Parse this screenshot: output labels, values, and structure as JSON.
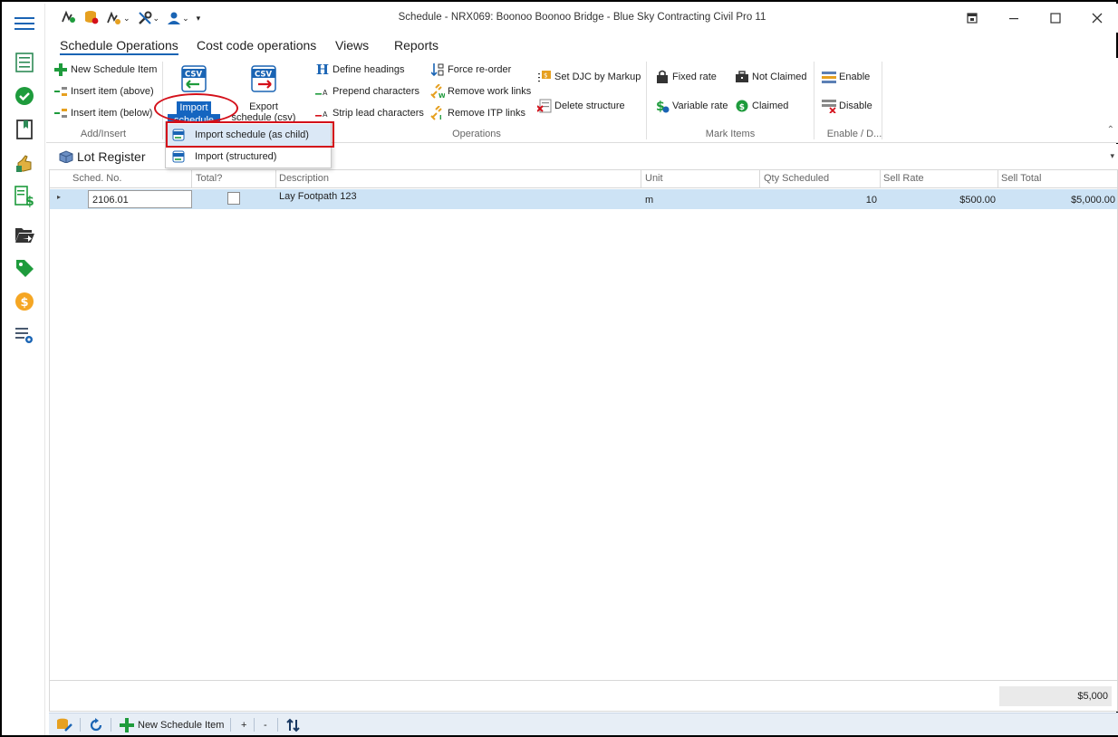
{
  "window": {
    "title": "Schedule - NRX069: Boonoo Boonoo Bridge - Blue Sky Contracting Civil Pro 11",
    "controls": [
      "restore-alt",
      "minimize",
      "maximize",
      "close"
    ]
  },
  "tabs": [
    {
      "label": "Schedule Operations",
      "active": true
    },
    {
      "label": "Cost code operations"
    },
    {
      "label": "Views"
    },
    {
      "label": "Reports"
    }
  ],
  "ribbon": {
    "add_insert": {
      "new_item": "New Schedule Item",
      "insert_above": "Insert item (above)",
      "insert_below": "Insert item (below)",
      "group_label": "Add/Insert"
    },
    "import": {
      "line1": "Import",
      "line2": "schedule ⌄",
      "csv_label": "CSV"
    },
    "export": {
      "line1": "Export",
      "line2": "schedule (csv) ⌄",
      "csv_label": "CSV"
    },
    "operations": {
      "define_headings": "Define headings",
      "prepend_chars": "Prepend characters",
      "strip_lead_chars": "Strip lead characters",
      "force_reorder": "Force re-order",
      "remove_work_links": "Remove work links",
      "remove_itp_links": "Remove ITP links",
      "set_djc": "Set DJC by Markup",
      "delete_structure": "Delete structure",
      "group_label": "Operations"
    },
    "mark_items": {
      "fixed_rate": "Fixed rate",
      "variable_rate": "Variable rate",
      "not_claimed": "Not Claimed",
      "claimed": "Claimed",
      "group_label": "Mark Items"
    },
    "enable_disable": {
      "enable": "Enable",
      "disable": "Disable",
      "group_label": "Enable / D..."
    }
  },
  "dropdown": {
    "items": [
      {
        "label": "Import schedule (as child)",
        "highlighted": true
      },
      {
        "label": "Import (structured)"
      }
    ]
  },
  "lot_register": {
    "title": "Lot Register"
  },
  "grid": {
    "columns": [
      "Sched. No.",
      "Total?",
      "Description",
      "Unit",
      "Qty Scheduled",
      "Sell Rate",
      "Sell Total"
    ],
    "rows": [
      {
        "sched_no": "2106.01",
        "total": false,
        "description": "Lay Footpath  123",
        "unit": "m",
        "qty": "10",
        "sell_rate": "$500.00",
        "sell_total": "$5,000.00"
      }
    ],
    "footer_total": "$5,000"
  },
  "bottom_toolbar": {
    "new_item": "New Schedule Item",
    "plus": "+",
    "minus": "-"
  },
  "colors": {
    "accent": "#1565c0",
    "highlight_red": "#d4101a",
    "row_selected": "#cde3f5",
    "bottom_bar": "#e7eef6"
  }
}
